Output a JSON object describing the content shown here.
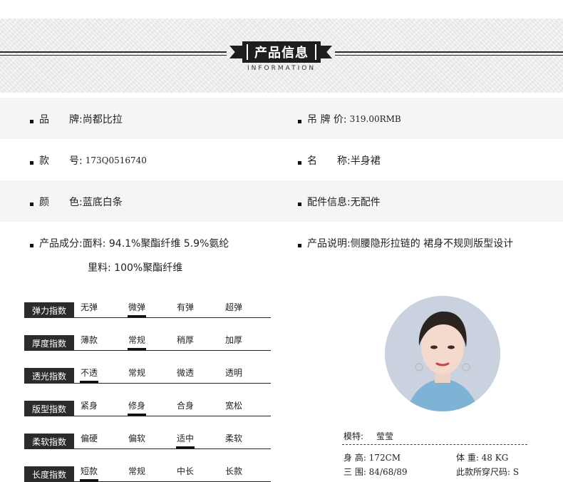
{
  "header": {
    "title": "产品信息",
    "subtitle": "INFORMATION"
  },
  "info": {
    "brand": {
      "label": "品　　牌:",
      "value": "尚都比拉"
    },
    "tag_price": {
      "label": "吊 牌 价:",
      "value": "319.00RMB"
    },
    "style_no": {
      "label": "款　　号:",
      "value": "173Q0516740"
    },
    "name": {
      "label": "名　　称:",
      "value": "半身裙"
    },
    "color": {
      "label": "颜　　色:",
      "value": "蓝底白条"
    },
    "accessory": {
      "label": "配件信息:",
      "value": "无配件"
    },
    "composition": {
      "label": "产品成分:",
      "line1": "面料: 94.1%聚酯纤维 5.9%氨纶",
      "line2": "里料: 100%聚酯纤维"
    },
    "description": {
      "label": "产品说明:",
      "value": "侧腰隐形拉链的 裙身不规则版型设计"
    }
  },
  "indices": [
    {
      "label": "弹力指数",
      "options": [
        "无弹",
        "微弹",
        "有弹",
        "超弹"
      ],
      "selected": 1
    },
    {
      "label": "厚度指数",
      "options": [
        "薄款",
        "常规",
        "稍厚",
        "加厚"
      ],
      "selected": 1
    },
    {
      "label": "透光指数",
      "options": [
        "不透",
        "常规",
        "微透",
        "透明"
      ],
      "selected": 0
    },
    {
      "label": "版型指数",
      "options": [
        "紧身",
        "修身",
        "合身",
        "宽松"
      ],
      "selected": 1
    },
    {
      "label": "柔软指数",
      "options": [
        "偏硬",
        "偏软",
        "适中",
        "柔软"
      ],
      "selected": 2
    },
    {
      "label": "长度指数",
      "options": [
        "短款",
        "常规",
        "中长",
        "长款"
      ],
      "selected": 0
    }
  ],
  "model": {
    "name_label": "模特:",
    "name": "莹莹",
    "height": "身 高: 172CM",
    "weight": "体 重: 48 KG",
    "measurements": "三 围: 84/68/89",
    "size": "此款所穿尺码: S"
  },
  "colors": {
    "dark": "#2b2b2b",
    "band": "#ececec",
    "shaded_row": "#f5f5f5",
    "avatar_bg": "#c9d2de"
  }
}
